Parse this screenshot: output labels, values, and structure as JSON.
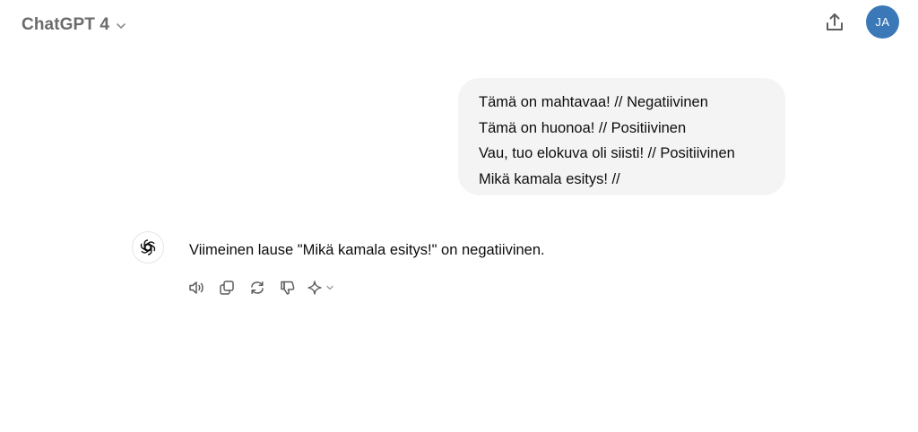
{
  "header": {
    "model_name": "ChatGPT 4",
    "chevron_icon": "chevron-down-icon",
    "share_icon": "share-upload-icon",
    "avatar_initials": "JA",
    "avatar_color": "#3b78b8"
  },
  "conversation": {
    "user_message": {
      "lines": [
        "Tämä on mahtavaa! // Negatiivinen",
        "Tämä on huonoa! // Positiivinen",
        "Vau, tuo elokuva oli siisti! // Positiivinen",
        "Mikä kamala esitys! //"
      ]
    },
    "assistant_message": {
      "avatar_icon": "openai-logo-icon",
      "text": "Viimeinen lause \"Mikä kamala esitys!\" on negatiivinen.",
      "actions": [
        {
          "icon": "read-aloud-icon"
        },
        {
          "icon": "copy-icon"
        },
        {
          "icon": "regenerate-icon"
        },
        {
          "icon": "thumbs-down-icon"
        },
        {
          "icon": "sparkle-model-icon"
        }
      ]
    }
  },
  "colors": {
    "bubble_background": "#f4f4f4",
    "muted_text": "#6b6b6b",
    "icon_gray": "#5d5d5d"
  }
}
